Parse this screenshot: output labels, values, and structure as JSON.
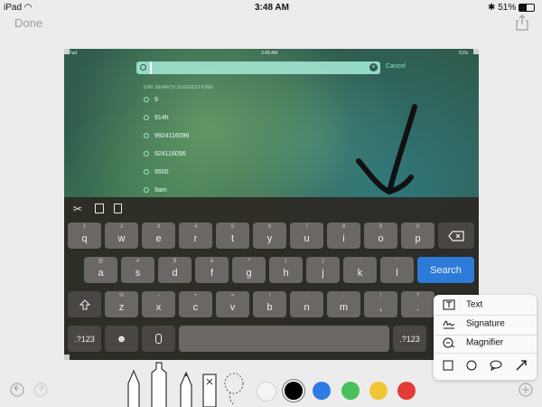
{
  "status_bar": {
    "left": "iPad",
    "time": "3:48 AM",
    "battery": "51%"
  },
  "header": {
    "done_label": "Done",
    "share_icon": "share-icon"
  },
  "screenshot": {
    "status_left": "iPad",
    "time": "3:48 AM",
    "battery": "51%",
    "search_placeholder": "",
    "cancel_label": "Cancel",
    "suggestions_title": "SIRI SEARCH SUGGESTIONS",
    "suggestions": [
      "9",
      "914h",
      "9924116096",
      "924116096",
      "9500",
      "9am"
    ],
    "keyboard": {
      "row1": [
        {
          "alt": "1",
          "main": "q"
        },
        {
          "alt": "2",
          "main": "w"
        },
        {
          "alt": "3",
          "main": "e"
        },
        {
          "alt": "4",
          "main": "r"
        },
        {
          "alt": "5",
          "main": "t"
        },
        {
          "alt": "6",
          "main": "y"
        },
        {
          "alt": "7",
          "main": "u"
        },
        {
          "alt": "8",
          "main": "i"
        },
        {
          "alt": "9",
          "main": "o"
        },
        {
          "alt": "0",
          "main": "p"
        }
      ],
      "row2": [
        {
          "alt": "@",
          "main": "a"
        },
        {
          "alt": "#",
          "main": "s"
        },
        {
          "alt": "$",
          "main": "d"
        },
        {
          "alt": "&",
          "main": "f"
        },
        {
          "alt": "*",
          "main": "g"
        },
        {
          "alt": "(",
          "main": "h"
        },
        {
          "alt": ")",
          "main": "j"
        },
        {
          "alt": "'",
          "main": "k"
        },
        {
          "alt": "\"",
          "main": "l"
        }
      ],
      "row3": [
        {
          "alt": "%",
          "main": "z"
        },
        {
          "alt": "-",
          "main": "x"
        },
        {
          "alt": "+",
          "main": "c"
        },
        {
          "alt": "=",
          "main": "v"
        },
        {
          "alt": "/",
          "main": "b"
        },
        {
          "alt": ";",
          "main": "n"
        },
        {
          "alt": ":",
          "main": "m"
        },
        {
          "alt": "!",
          "main": ","
        },
        {
          "alt": "?",
          "main": "."
        }
      ],
      "search_label": "Search",
      "num_label": ".?123"
    }
  },
  "toolbar": {
    "colors": [
      "#f4f4f4",
      "#000000",
      "#2f7be6",
      "#4cc05a",
      "#f2c532",
      "#e43b36"
    ]
  },
  "popup": {
    "items": [
      "Text",
      "Signature",
      "Magnifier"
    ]
  }
}
